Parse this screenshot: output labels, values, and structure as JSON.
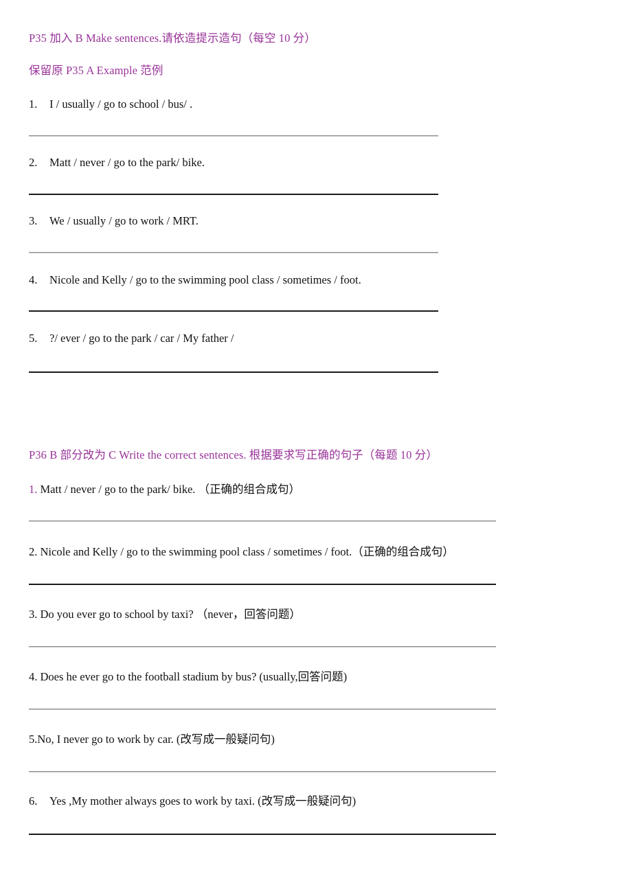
{
  "document": {
    "colors": {
      "heading_purple": "#993399",
      "body_black": "#111111",
      "rule_dark": "#1a1a1a",
      "rule_light": "#8e8e8e",
      "page_background": "#ffffff"
    },
    "section_p35": {
      "heading": "P35  加入 B Make sentences.请依造提示造句（每空 10 分）",
      "subheading": "保留原 P35 A Example 范例",
      "items": [
        {
          "number": "1.",
          "text": "I / usually / go to school / bus/ ."
        },
        {
          "number": "2.",
          "text": "Matt / never / go to the park/ bike."
        },
        {
          "number": "3.",
          "text": "We / usually / go to work / MRT."
        },
        {
          "number": "4.",
          "text": "Nicole and Kelly / go to the swimming pool class / sometimes / foot."
        },
        {
          "number": "5.",
          "text": "?/ ever / go to the park / car / My father /"
        }
      ]
    },
    "section_p36": {
      "heading": "P36 B 部分改为 C Write the correct sentences. 根据要求写正确的句子（每题 10 分）",
      "items": [
        {
          "number": "1.",
          "text": " Matt / never / go to the park/ bike.  （正确的组合成句）"
        },
        {
          "number": "2.",
          "text": " Nicole and Kelly / go to the swimming pool class / sometimes / foot.（正确的组合成句）"
        },
        {
          "number": "3.",
          "text": " Do you ever go to school by taxi?  （never，回答问题）"
        },
        {
          "number": "4.",
          "text": " Does he ever go to the football stadium by bus? (usually,回答问题)"
        },
        {
          "number": "5.",
          "text": "No, I never go to work by car. (改写成一般疑问句)"
        },
        {
          "number": "6.",
          "text": "Yes ,My mother always goes to work by taxi. (改写成一般疑问句)"
        }
      ]
    }
  }
}
